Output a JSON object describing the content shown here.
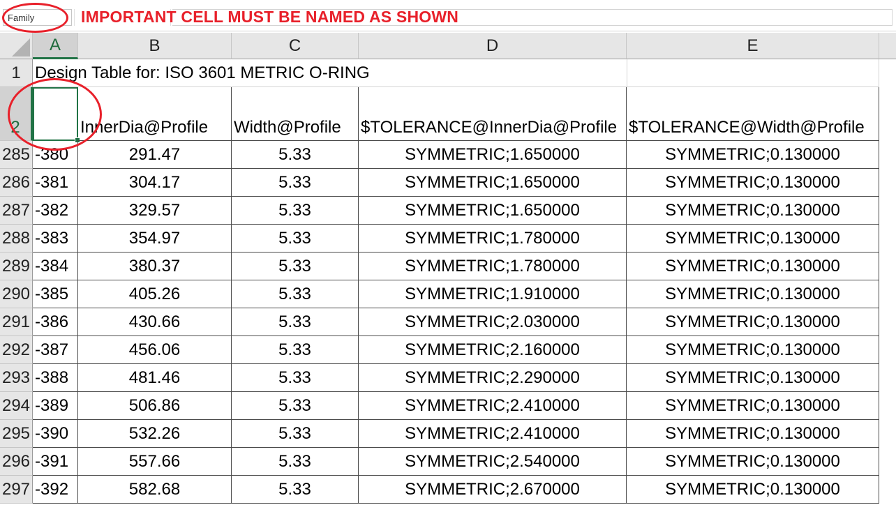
{
  "name_box": {
    "value": "Family"
  },
  "annotation": "IMPORTANT CELL MUST BE NAMED AS SHOWN",
  "columns": [
    "A",
    "B",
    "C",
    "D",
    "E"
  ],
  "row1": {
    "num": "1",
    "text": "Design Table for: ISO 3601 METRIC O-RING"
  },
  "row2": {
    "num": "2",
    "cells": [
      "",
      "InnerDia@Profile",
      "Width@Profile",
      "$TOLERANCE@InnerDia@Profile",
      "$TOLERANCE@Width@Profile"
    ]
  },
  "rows": [
    {
      "num": "285",
      "a": "-380",
      "b": "291.47",
      "c": "5.33",
      "d": "SYMMETRIC;1.650000",
      "e": "SYMMETRIC;0.130000"
    },
    {
      "num": "286",
      "a": "-381",
      "b": "304.17",
      "c": "5.33",
      "d": "SYMMETRIC;1.650000",
      "e": "SYMMETRIC;0.130000"
    },
    {
      "num": "287",
      "a": "-382",
      "b": "329.57",
      "c": "5.33",
      "d": "SYMMETRIC;1.650000",
      "e": "SYMMETRIC;0.130000"
    },
    {
      "num": "288",
      "a": "-383",
      "b": "354.97",
      "c": "5.33",
      "d": "SYMMETRIC;1.780000",
      "e": "SYMMETRIC;0.130000"
    },
    {
      "num": "289",
      "a": "-384",
      "b": "380.37",
      "c": "5.33",
      "d": "SYMMETRIC;1.780000",
      "e": "SYMMETRIC;0.130000"
    },
    {
      "num": "290",
      "a": "-385",
      "b": "405.26",
      "c": "5.33",
      "d": "SYMMETRIC;1.910000",
      "e": "SYMMETRIC;0.130000"
    },
    {
      "num": "291",
      "a": "-386",
      "b": "430.66",
      "c": "5.33",
      "d": "SYMMETRIC;2.030000",
      "e": "SYMMETRIC;0.130000"
    },
    {
      "num": "292",
      "a": "-387",
      "b": "456.06",
      "c": "5.33",
      "d": "SYMMETRIC;2.160000",
      "e": "SYMMETRIC;0.130000"
    },
    {
      "num": "293",
      "a": "-388",
      "b": "481.46",
      "c": "5.33",
      "d": "SYMMETRIC;2.290000",
      "e": "SYMMETRIC;0.130000"
    },
    {
      "num": "294",
      "a": "-389",
      "b": "506.86",
      "c": "5.33",
      "d": "SYMMETRIC;2.410000",
      "e": "SYMMETRIC;0.130000"
    },
    {
      "num": "295",
      "a": "-390",
      "b": "532.26",
      "c": "5.33",
      "d": "SYMMETRIC;2.410000",
      "e": "SYMMETRIC;0.130000"
    },
    {
      "num": "296",
      "a": "-391",
      "b": "557.66",
      "c": "5.33",
      "d": "SYMMETRIC;2.540000",
      "e": "SYMMETRIC;0.130000"
    },
    {
      "num": "297",
      "a": "-392",
      "b": "582.68",
      "c": "5.33",
      "d": "SYMMETRIC;2.670000",
      "e": "SYMMETRIC;0.130000"
    }
  ],
  "colors": {
    "accent": "#217346",
    "annotation": "#e8202a"
  }
}
